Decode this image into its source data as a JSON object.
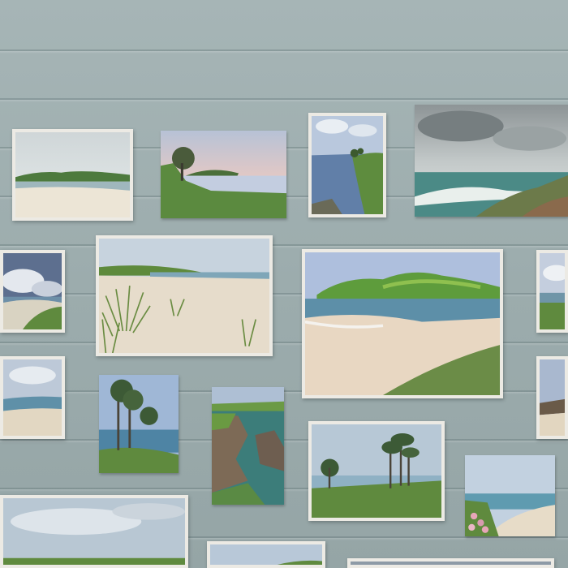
{
  "scene": {
    "subject": "gallery-wall-of-coastal-landscape-paintings",
    "colors": {
      "wall": "#9cacad",
      "frame": "#eceae4",
      "sea": "#5f8fa3",
      "sand": "#e6dccb",
      "grass": "#5c8a3c",
      "sky": "#c8d6e0"
    },
    "paintings": [
      "misty-beach-with-green-headland",
      "headland-with-tree-at-sunset",
      "river-estuary-with-trees",
      "stormy-sky-over-coastline",
      "cloudy-sky-over-dunes",
      "dune-grass-on-beach",
      "green-headland-and-sandy-bay",
      "pine-trees-over-bay",
      "rocky-cliffs-over-cove",
      "pine-trees-on-headland",
      "beach-with-pink-flowers",
      "sandy-beach-under-clouds"
    ]
  }
}
